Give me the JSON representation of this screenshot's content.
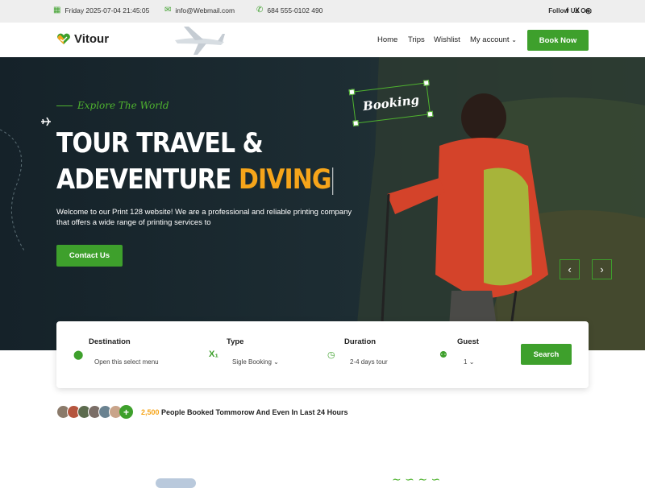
{
  "topbar": {
    "date": "Friday 2025-07-04 21:45:05",
    "email": "info@Webmail.com",
    "phone": "684 555-0102 490",
    "follow_label": "Follow Us On:",
    "social": [
      "f",
      "X",
      "◎"
    ]
  },
  "header": {
    "logo_text": "Vitour",
    "nav": [
      "Home",
      "Trips",
      "Wishlist",
      "My account"
    ],
    "book_label": "Book Now"
  },
  "hero": {
    "tagline": "Explore The World",
    "title_line1": "TOUR TRAVEL &",
    "title_line2_prefix": "ADEVENTURE ",
    "title_line2_highlight": "DIVING",
    "description": "Welcome to our Print 128 website! We are a professional and reliable printing company that offers a wide range of printing services to",
    "contact_label": "Contact Us",
    "booking_tag": "Booking",
    "prev_icon": "‹",
    "next_icon": "›"
  },
  "search": {
    "destination_label": "Destination",
    "destination_value": "Open this select menu",
    "type_label": "Type",
    "type_value": "Sigle Booking",
    "duration_label": "Duration",
    "duration_value": "2-4 days tour",
    "guest_label": "Guest",
    "guest_value": "1",
    "button_label": "Search"
  },
  "booked": {
    "count": "2,500",
    "text": " People Booked Tommorow And Even In Last 24 Hours",
    "plus": "+"
  },
  "colors": {
    "accent": "#3ea02c",
    "highlight": "#f6a51a"
  }
}
